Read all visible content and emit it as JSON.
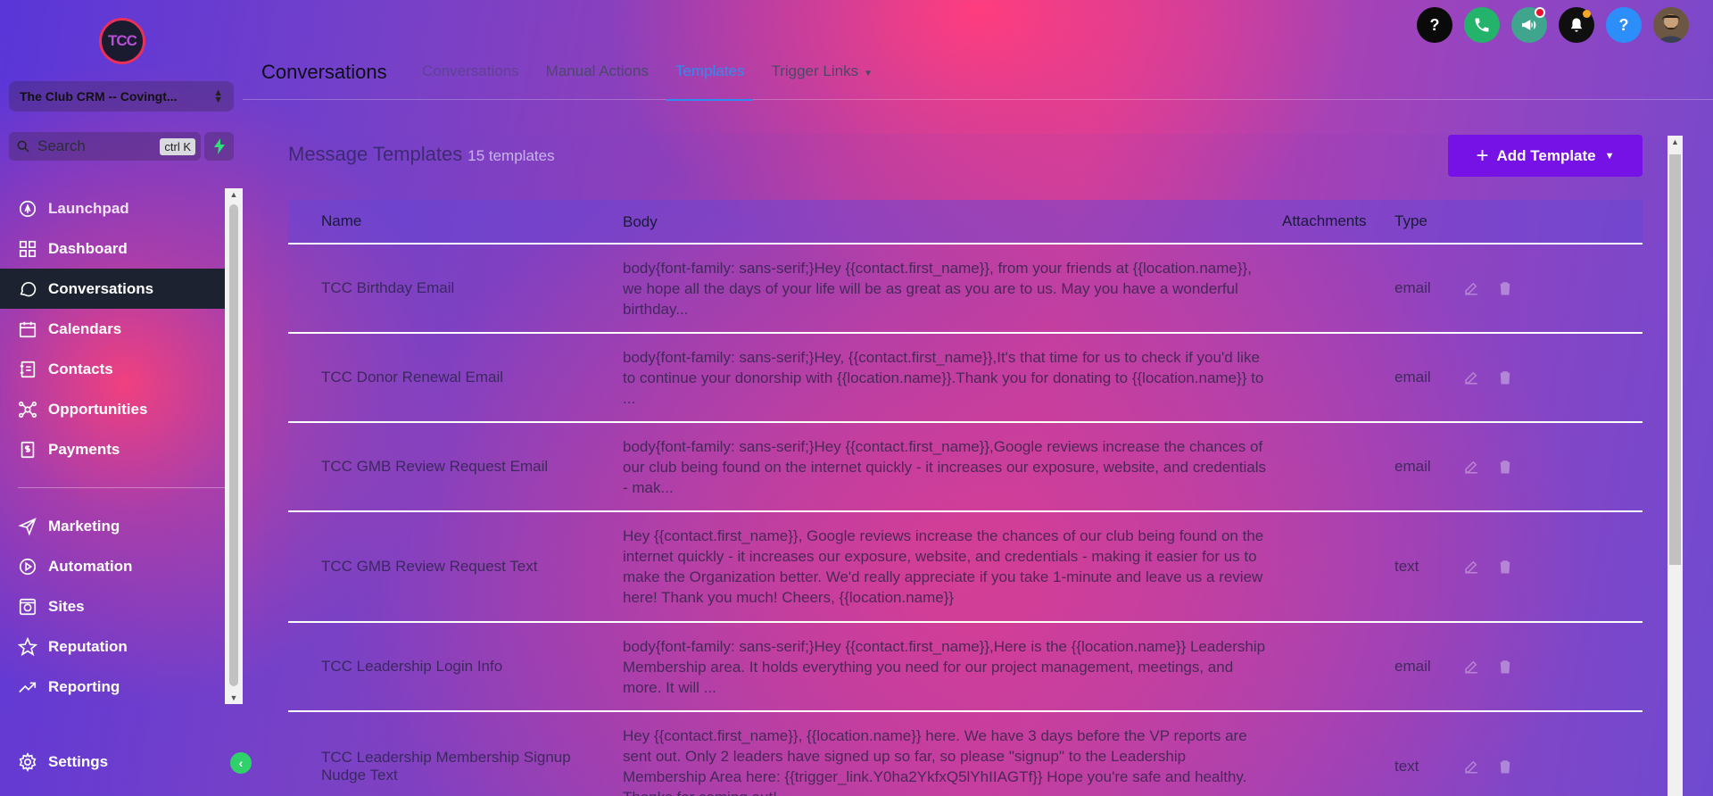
{
  "sidebar": {
    "logo_text": "TCC",
    "account_name": "The Club CRM -- Covingt...",
    "search_placeholder": "Search",
    "search_shortcut": "ctrl K",
    "nav_top": [
      {
        "label": "Launchpad",
        "icon": "rocket-icon"
      },
      {
        "label": "Dashboard",
        "icon": "grid-icon"
      },
      {
        "label": "Conversations",
        "icon": "chat-bubble-icon",
        "active": true
      },
      {
        "label": "Calendars",
        "icon": "calendar-icon"
      },
      {
        "label": "Contacts",
        "icon": "contact-book-icon"
      },
      {
        "label": "Opportunities",
        "icon": "network-icon"
      },
      {
        "label": "Payments",
        "icon": "receipt-icon"
      }
    ],
    "nav_bottom": [
      {
        "label": "Marketing",
        "icon": "paper-plane-icon"
      },
      {
        "label": "Automation",
        "icon": "play-circle-icon"
      },
      {
        "label": "Sites",
        "icon": "globe-icon"
      },
      {
        "label": "Reputation",
        "icon": "star-icon"
      },
      {
        "label": "Reporting",
        "icon": "trend-line-icon"
      }
    ],
    "settings_label": "Settings"
  },
  "header": {
    "title": "Conversations",
    "tabs": [
      {
        "label": "Conversations",
        "state": "faded"
      },
      {
        "label": "Manual Actions",
        "state": "normal"
      },
      {
        "label": "Templates",
        "state": "active"
      },
      {
        "label": "Trigger Links",
        "state": "dropdown"
      }
    ]
  },
  "top_icons": [
    "help-icon",
    "phone-icon",
    "megaphone-icon",
    "bell-icon",
    "help-icon",
    "avatar"
  ],
  "main": {
    "heading": "Message Templates",
    "count": "15 templates",
    "add_button_label": "Add Template",
    "accent_color": "#7712e6"
  },
  "table": {
    "columns": [
      "Name",
      "Body",
      "Attachments",
      "Type"
    ],
    "rows": [
      {
        "name": "TCC Birthday Email",
        "body": "body{font-family: sans-serif;}Hey {{contact.first_name}}, from your friends at {{location.name}}, we hope all the days of your life will be as great as you are to us. May you have a wonderful birthday...",
        "attachments": "",
        "type": "email"
      },
      {
        "name": "TCC Donor Renewal Email",
        "body": "body{font-family: sans-serif;}Hey, {{contact.first_name}},It's that time for us to check if you'd like to continue your donorship with {{location.name}}.Thank you for donating to {{location.name}} to ...",
        "attachments": "",
        "type": "email"
      },
      {
        "name": "TCC GMB Review Request Email",
        "body": "body{font-family: sans-serif;}Hey {{contact.first_name}},Google reviews increase the chances of our club being found on the internet quickly - it increases our exposure, website, and credentials - mak...",
        "attachments": "",
        "type": "email"
      },
      {
        "name": "TCC GMB Review Request Text",
        "body": "Hey {{contact.first_name}}, Google reviews increase the chances of our club being found on the internet quickly - it increases our exposure, website, and credentials - making it easier for us to make the Organization better. We'd really appreciate if you take 1-minute and leave us a review here! Thank you much! Cheers, {{location.name}}",
        "attachments": "",
        "type": "text"
      },
      {
        "name": "TCC Leadership Login Info",
        "body": "body{font-family: sans-serif;}Hey {{contact.first_name}},Here is the {{location.name}} Leadership Membership area. It holds everything you need for our project management, meetings, and more. It will ...",
        "attachments": "",
        "type": "email"
      },
      {
        "name": "TCC Leadership Membership Signup Nudge Text",
        "body": "Hey {{contact.first_name}}, {{location.name}} here. We have 3 days before the VP reports are sent out. Only 2 leaders have signed up so far, so please \"signup\" to the Leadership Membership Area here: {{trigger_link.Y0ha2YkfxQ5lYhIIAGTf}} Hope you're safe and healthy. Thanks for coming out!",
        "attachments": "",
        "type": "text"
      }
    ]
  }
}
